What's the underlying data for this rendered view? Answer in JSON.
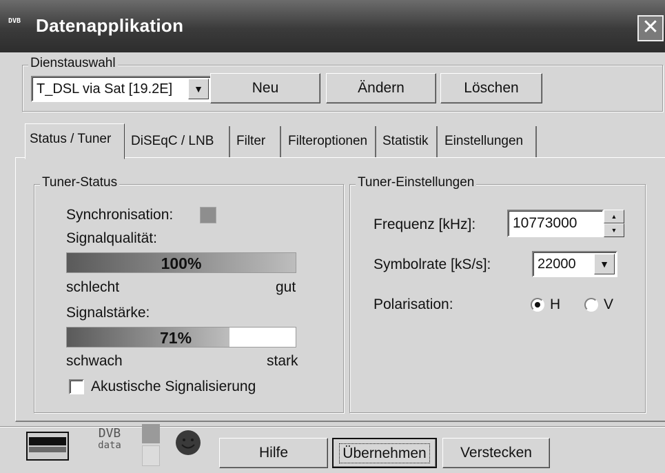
{
  "window": {
    "title": "Datenapplikation",
    "icon_text": "DVB",
    "close_glyph": "✕"
  },
  "service_group": {
    "legend": "Dienstauswahl",
    "selected_service": "T_DSL via Sat [19.2E]",
    "buttons": {
      "new": "Neu",
      "change": "Ändern",
      "delete": "Löschen"
    }
  },
  "tabs": [
    {
      "label": "Status / Tuner",
      "active": true
    },
    {
      "label": "DiSEqC / LNB",
      "active": false
    },
    {
      "label": "Filter",
      "active": false
    },
    {
      "label": "Filteroptionen",
      "active": false
    },
    {
      "label": "Statistik",
      "active": false
    },
    {
      "label": "Einstellungen",
      "active": false
    }
  ],
  "tuner_status": {
    "legend": "Tuner-Status",
    "sync_label": "Synchronisation:",
    "signal_quality": {
      "label": "Signalqualität:",
      "value_pct": 100,
      "value_text": "100%",
      "low_label": "schlecht",
      "high_label": "gut"
    },
    "signal_strength": {
      "label": "Signalstärke:",
      "value_pct": 71,
      "value_text": "71%",
      "low_label": "schwach",
      "high_label": "stark"
    },
    "acoustic_label": "Akustische Signalisierung",
    "acoustic_checked": false
  },
  "tuner_settings": {
    "legend": "Tuner-Einstellungen",
    "frequency_label": "Frequenz [kHz]:",
    "frequency_value": "10773000",
    "symbolrate_label": "Symbolrate [kS/s]:",
    "symbolrate_value": "22000",
    "polarisation_label": "Polarisation:",
    "polarisation_options": [
      "H",
      "V"
    ],
    "polarisation_selected": "H"
  },
  "footer": {
    "dvb_logo_top": "DVB",
    "dvb_logo_bottom": "data",
    "buttons": {
      "help": "Hilfe",
      "apply": "Übernehmen",
      "hide": "Verstecken"
    }
  },
  "colors": {
    "titlebar": "#3b3b3b",
    "face": "#d6d6d6",
    "bar_fill_start": "#5a5a5a",
    "bar_fill_end": "#bdbdbd"
  }
}
